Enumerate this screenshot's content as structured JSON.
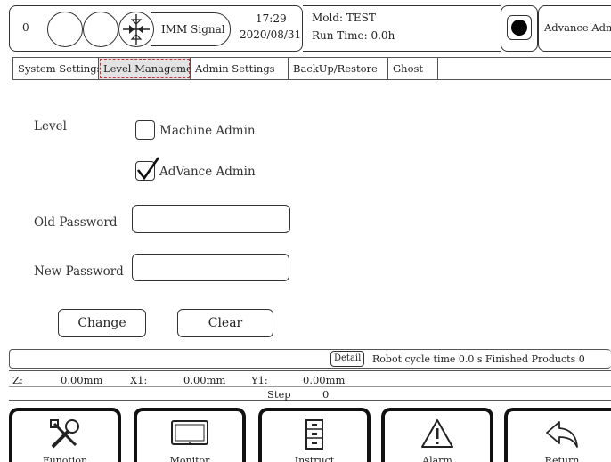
{
  "header": {
    "counter": "0",
    "signal_label": "IMM Signal",
    "time": "17:29",
    "date": "2020/08/31",
    "mold": "Mold: TEST",
    "run_time": "Run Time: 0.0h",
    "user": "Advance Admin"
  },
  "tabs": [
    "System Settings",
    "Level Management",
    "Admin Settings",
    "BackUp/Restore",
    "Ghost"
  ],
  "active_tab": "Level Management",
  "form": {
    "level_label": "Level",
    "option_machine": "Machine Admin",
    "option_machine_checked": false,
    "option_advance": "AdVance Admin",
    "option_advance_checked": true,
    "old_password_label": "Old Password",
    "old_password_value": "",
    "new_password_label": "New Password",
    "new_password_value": "",
    "change_label": "Change",
    "clear_label": "Clear"
  },
  "status": {
    "detail_label": "Detail",
    "message": "Robot cycle time 0.0 s Finished Products  0"
  },
  "coords": {
    "z_label": "Z:",
    "z_value": "0.00mm",
    "x1_label": "X1:",
    "x1_value": "0.00mm",
    "y1_label": "Y1:",
    "y1_value": "0.00mm",
    "step_label": "Step",
    "step_value": "0"
  },
  "bottom": {
    "function": "Funotion",
    "monitor": "Monitor",
    "instruct": "Instruct",
    "alarm": "Alarm",
    "return": "Return"
  },
  "colors": {
    "active_tab_bg": "#e3e3e3",
    "active_outline": "#cc3333",
    "frame": "#111111"
  }
}
